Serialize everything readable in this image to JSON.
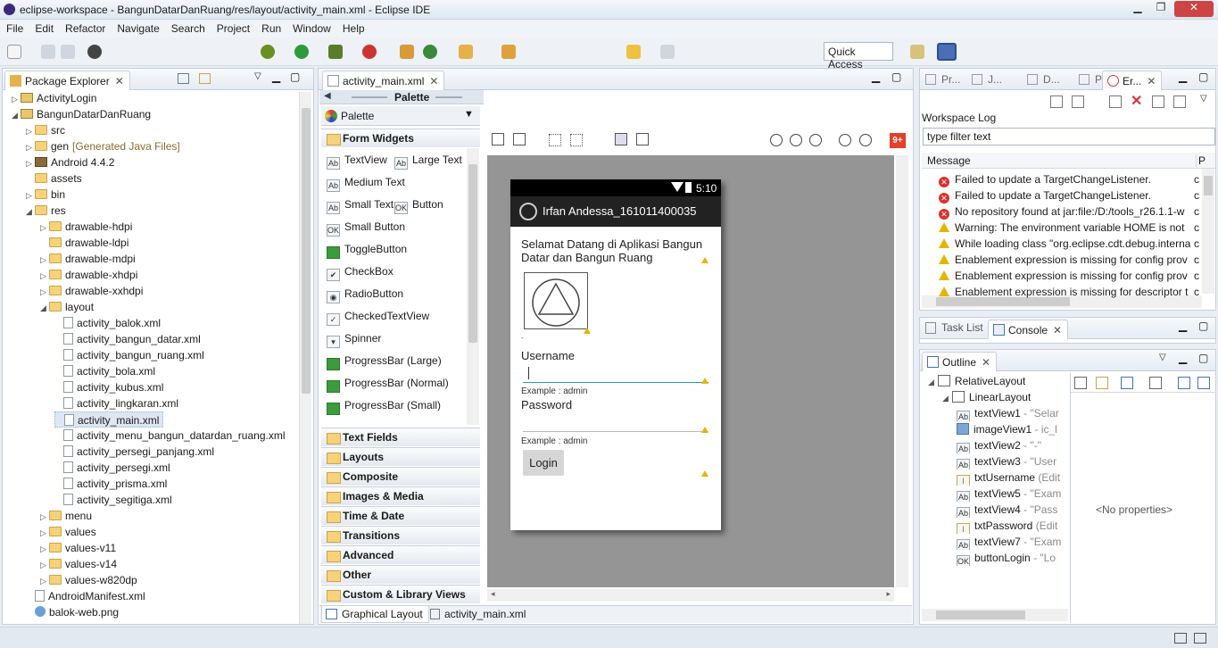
{
  "window": {
    "title": "eclipse-workspace - BangunDatarDanRuang/res/layout/activity_main.xml - Eclipse IDE"
  },
  "menu": [
    "File",
    "Edit",
    "Refactor",
    "Navigate",
    "Search",
    "Project",
    "Run",
    "Window",
    "Help"
  ],
  "quick_access": "Quick Access",
  "package_explorer": {
    "tab": "Package Explorer",
    "items": [
      {
        "label": "ActivityLogin",
        "depth": 0,
        "arrow": "▷",
        "kind": "proj"
      },
      {
        "label": "BangunDatarDanRuang",
        "depth": 0,
        "arrow": "◢",
        "kind": "proj"
      },
      {
        "label": "src",
        "depth": 1,
        "arrow": "▷",
        "kind": "folder"
      },
      {
        "label": "gen",
        "extra": "[Generated Java Files]",
        "depth": 1,
        "arrow": "▷",
        "kind": "folder"
      },
      {
        "label": "Android 4.4.2",
        "depth": 1,
        "arrow": "▷",
        "kind": "lib"
      },
      {
        "label": "assets",
        "depth": 1,
        "arrow": "",
        "kind": "folder"
      },
      {
        "label": "bin",
        "depth": 1,
        "arrow": "▷",
        "kind": "folder"
      },
      {
        "label": "res",
        "depth": 1,
        "arrow": "◢",
        "kind": "folder"
      },
      {
        "label": "drawable-hdpi",
        "depth": 2,
        "arrow": "▷",
        "kind": "folder"
      },
      {
        "label": "drawable-ldpi",
        "depth": 2,
        "arrow": "",
        "kind": "folder"
      },
      {
        "label": "drawable-mdpi",
        "depth": 2,
        "arrow": "▷",
        "kind": "folder"
      },
      {
        "label": "drawable-xhdpi",
        "depth": 2,
        "arrow": "▷",
        "kind": "folder"
      },
      {
        "label": "drawable-xxhdpi",
        "depth": 2,
        "arrow": "▷",
        "kind": "folder"
      },
      {
        "label": "layout",
        "depth": 2,
        "arrow": "◢",
        "kind": "folder"
      },
      {
        "label": "activity_balok.xml",
        "depth": 3,
        "arrow": "",
        "kind": "xml"
      },
      {
        "label": "activity_bangun_datar.xml",
        "depth": 3,
        "arrow": "",
        "kind": "xml"
      },
      {
        "label": "activity_bangun_ruang.xml",
        "depth": 3,
        "arrow": "",
        "kind": "xml"
      },
      {
        "label": "activity_bola.xml",
        "depth": 3,
        "arrow": "",
        "kind": "xml"
      },
      {
        "label": "activity_kubus.xml",
        "depth": 3,
        "arrow": "",
        "kind": "xml"
      },
      {
        "label": "activity_lingkaran.xml",
        "depth": 3,
        "arrow": "",
        "kind": "xml"
      },
      {
        "label": "activity_main.xml",
        "depth": 3,
        "arrow": "",
        "kind": "xml",
        "selected": true
      },
      {
        "label": "activity_menu_bangun_datardan_ruang.xml",
        "depth": 3,
        "arrow": "",
        "kind": "xml"
      },
      {
        "label": "activity_persegi_panjang.xml",
        "depth": 3,
        "arrow": "",
        "kind": "xml"
      },
      {
        "label": "activity_persegi.xml",
        "depth": 3,
        "arrow": "",
        "kind": "xml"
      },
      {
        "label": "activity_prisma.xml",
        "depth": 3,
        "arrow": "",
        "kind": "xml"
      },
      {
        "label": "activity_segitiga.xml",
        "depth": 3,
        "arrow": "",
        "kind": "xml"
      },
      {
        "label": "menu",
        "depth": 2,
        "arrow": "▷",
        "kind": "folder"
      },
      {
        "label": "values",
        "depth": 2,
        "arrow": "▷",
        "kind": "folder"
      },
      {
        "label": "values-v11",
        "depth": 2,
        "arrow": "▷",
        "kind": "folder"
      },
      {
        "label": "values-v14",
        "depth": 2,
        "arrow": "▷",
        "kind": "folder"
      },
      {
        "label": "values-w820dp",
        "depth": 2,
        "arrow": "▷",
        "kind": "folder"
      },
      {
        "label": "AndroidManifest.xml",
        "depth": 1,
        "arrow": "",
        "kind": "xml"
      },
      {
        "label": "balok-web.png",
        "depth": 1,
        "arrow": "",
        "kind": "img"
      }
    ]
  },
  "editor": {
    "tab": "activity_main.xml",
    "palette_header": "Palette",
    "palette_title": "Palette",
    "form_widgets": "Form Widgets",
    "widgets": [
      [
        {
          "icon": "Ab",
          "label": "TextView"
        },
        {
          "icon": "Ab",
          "label": "Large Text"
        }
      ],
      [
        {
          "icon": "Ab",
          "label": "Medium Text"
        }
      ],
      [
        {
          "icon": "Ab",
          "label": "Small Text"
        },
        {
          "icon": "OK",
          "label": "Button"
        }
      ],
      [
        {
          "icon": "OK",
          "label": "Small Button"
        }
      ],
      [
        {
          "icon": "▬",
          "label": "ToggleButton"
        }
      ],
      [
        {
          "icon": "✔",
          "label": "CheckBox"
        }
      ],
      [
        {
          "icon": "◉",
          "label": "RadioButton"
        }
      ],
      [
        {
          "icon": "✓",
          "label": "CheckedTextView"
        }
      ],
      [
        {
          "icon": "▾",
          "label": "Spinner"
        }
      ],
      [
        {
          "icon": "▬",
          "label": "ProgressBar (Large)"
        }
      ],
      [
        {
          "icon": "▬",
          "label": "ProgressBar (Normal)"
        }
      ],
      [
        {
          "icon": "▬",
          "label": "ProgressBar (Small)"
        }
      ]
    ],
    "categories": [
      "Text Fields",
      "Layouts",
      "Composite",
      "Images & Media",
      "Time & Date",
      "Transitions",
      "Advanced",
      "Other",
      "Custom & Library Views"
    ],
    "bottom_tabs": [
      "Graphical Layout",
      "activity_main.xml"
    ],
    "badge": "9+"
  },
  "phone": {
    "time": "5:10",
    "app_title": "Irfan Andessa_161011400035",
    "welcome": "Selamat Datang di Aplikasi Bangun Datar dan Bangun Ruang",
    "dash": "-",
    "username_label": "Username",
    "username_hint": "Example : admin",
    "password_label": "Password",
    "password_hint": "Example : admin",
    "login": "Login"
  },
  "right_top": {
    "tabs": [
      "Pr...",
      "J...",
      "D...",
      "Pr...",
      "Er..."
    ],
    "workspace_log": "Workspace Log",
    "filter_placeholder": "type filter text",
    "col_message": "Message",
    "col_p": "P",
    "rows": [
      {
        "type": "err",
        "text": "Failed to update a TargetChangeListener."
      },
      {
        "type": "err",
        "text": "Failed to update a TargetChangeListener."
      },
      {
        "type": "err",
        "text": "No repository found at jar:file:/D:/tools_r26.1.1-w"
      },
      {
        "type": "warn",
        "text": "Warning: The environment variable HOME is not"
      },
      {
        "type": "warn",
        "text": "While loading class \"org.eclipse.cdt.debug.interna"
      },
      {
        "type": "warn",
        "text": "Enablement expression is missing for config prov"
      },
      {
        "type": "warn",
        "text": "Enablement expression is missing for config prov"
      },
      {
        "type": "warn",
        "text": "Enablement expression is missing for descriptor t"
      }
    ]
  },
  "console": {
    "tabs": [
      "Task List",
      "Console"
    ]
  },
  "outline": {
    "tab": "Outline",
    "no_props": "<No properties>",
    "items": [
      {
        "label": "RelativeLayout",
        "depth": 0
      },
      {
        "label": "LinearLayout",
        "depth": 1
      },
      {
        "label": "textView1",
        "extra": " - \"Selar",
        "depth": 2,
        "icon": "Ab"
      },
      {
        "label": "imageView1",
        "extra": " - ic_l",
        "depth": 2,
        "icon": "img"
      },
      {
        "label": "textView2",
        "extra": " - \"-\"",
        "depth": 2,
        "icon": "Ab"
      },
      {
        "label": "textView3",
        "extra": " - \"User",
        "depth": 2,
        "icon": "Ab"
      },
      {
        "label": "txtUsername",
        "extra": " (Edit",
        "depth": 2,
        "icon": "I"
      },
      {
        "label": "textView5",
        "extra": " - \"Exam",
        "depth": 2,
        "icon": "Ab"
      },
      {
        "label": "textView4",
        "extra": " - \"Pass",
        "depth": 2,
        "icon": "Ab"
      },
      {
        "label": "txtPassword",
        "extra": " (Edit",
        "depth": 2,
        "icon": "I"
      },
      {
        "label": "textView7",
        "extra": " - \"Exam",
        "depth": 2,
        "icon": "Ab"
      },
      {
        "label": "buttonLogin",
        "extra": " - \"Lo",
        "depth": 2,
        "icon": "OK"
      }
    ]
  }
}
